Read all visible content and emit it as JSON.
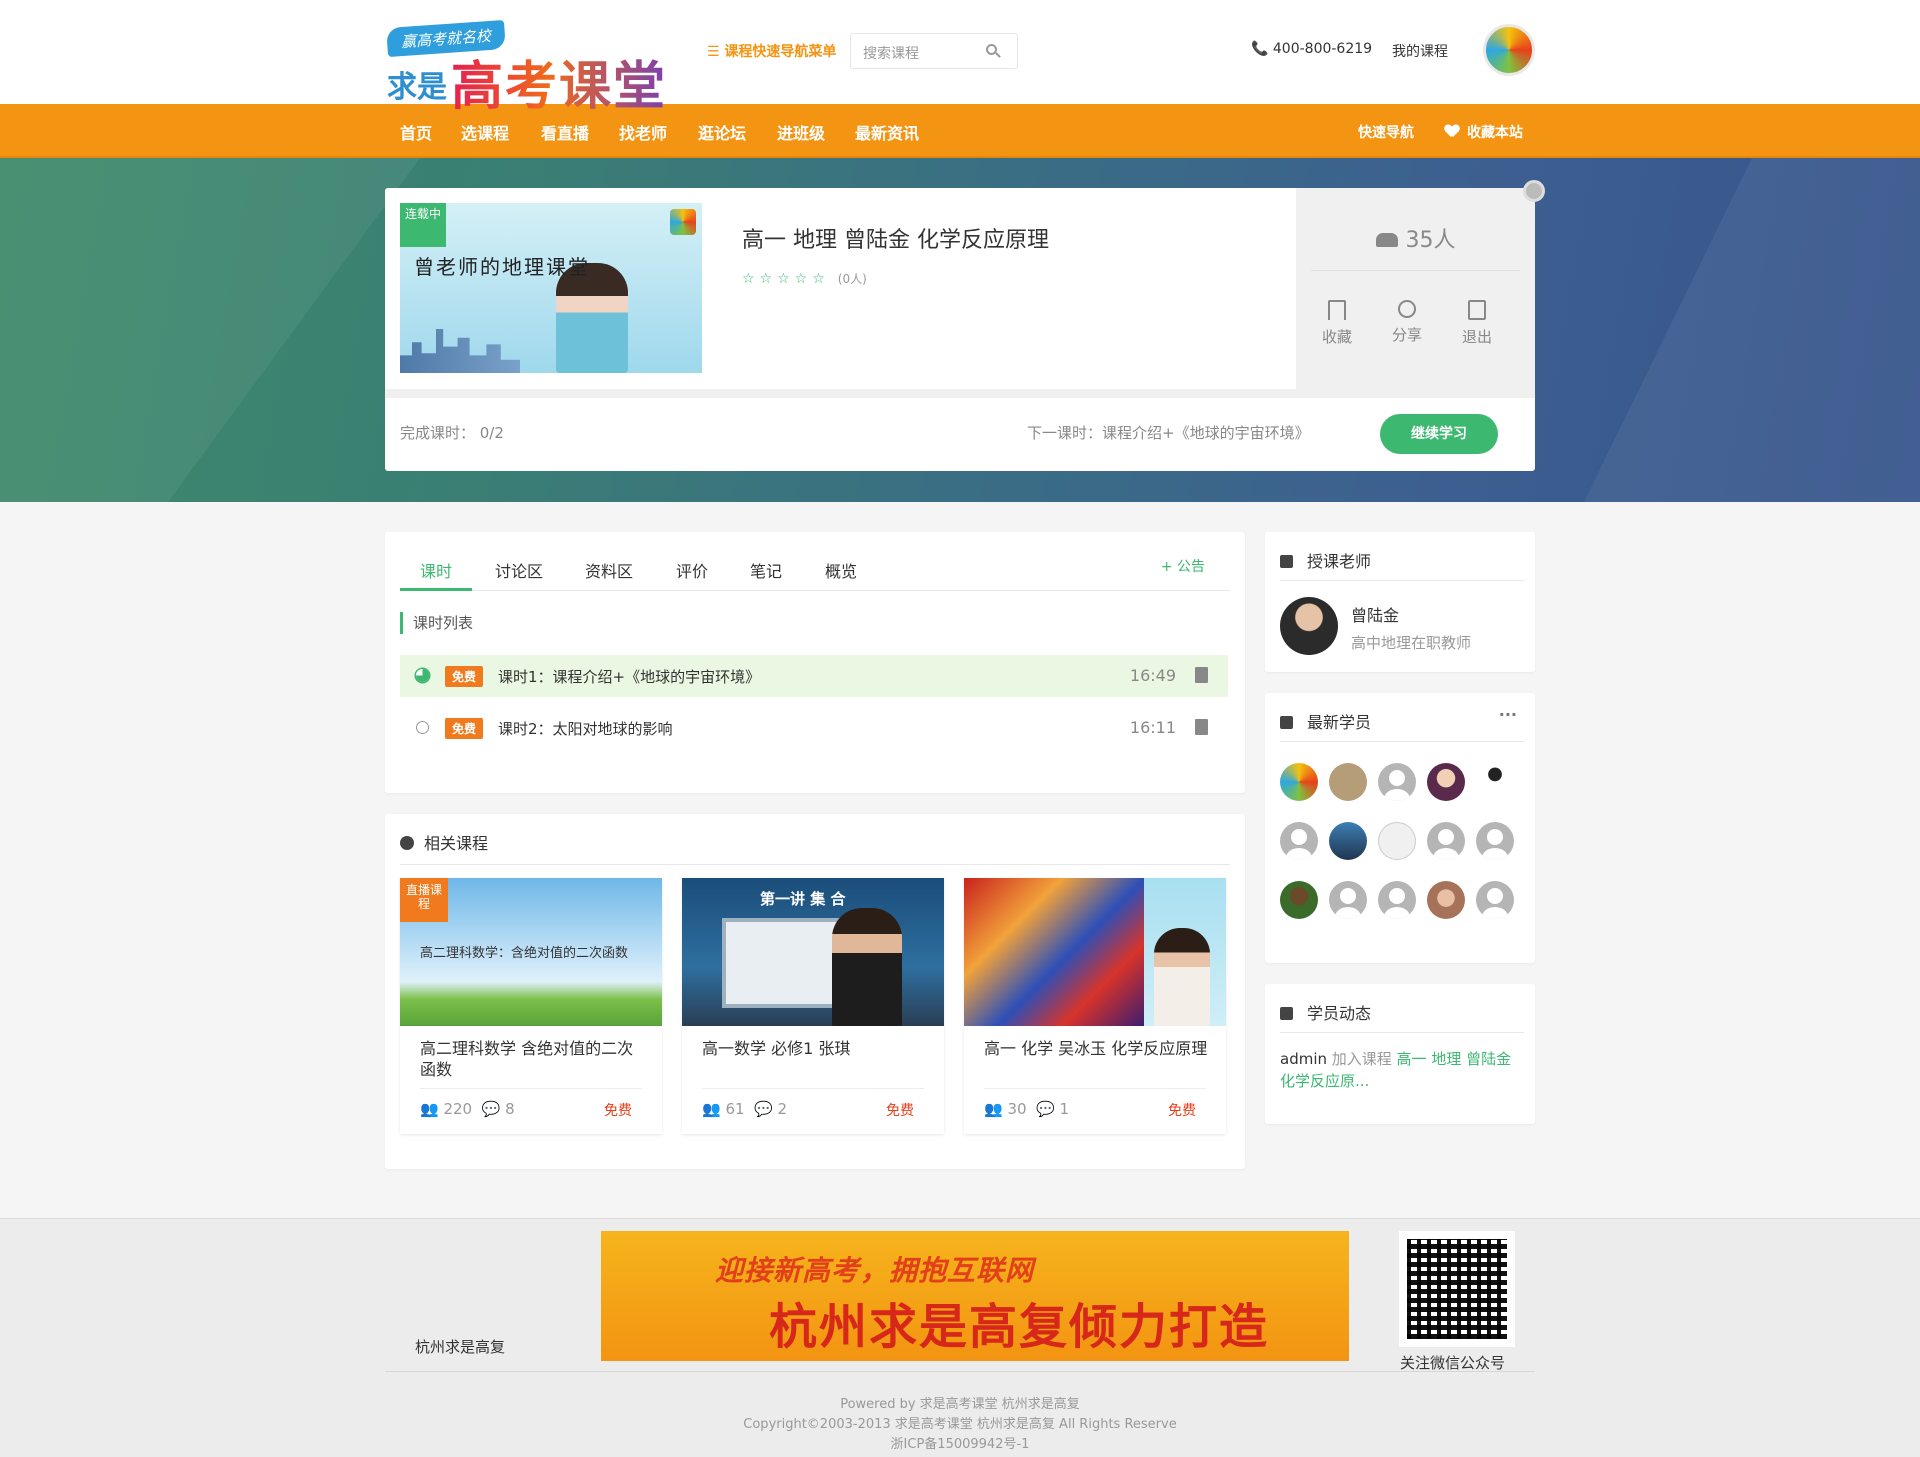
{
  "header": {
    "logo_tag": "赢高考就名校",
    "logo_prefix": "求是",
    "logo_main": "高考课堂",
    "quick_nav": "☰ 课程快速导航菜单",
    "search_placeholder": "搜索课程",
    "phone": "📞 400-800-6219",
    "my_courses": "我的课程"
  },
  "nav": {
    "items": [
      "首页",
      "选课程",
      "看直播",
      "找老师",
      "逛论坛",
      "进班级",
      "最新资讯"
    ],
    "quick": "快速导航",
    "favorite": "收藏本站"
  },
  "course": {
    "ribbon": "连载中",
    "thumb_title": "曾老师的地理课堂",
    "title": "高一 地理 曾陆金 化学反应原理",
    "stars": "☆☆☆☆☆",
    "rating_count": "(0人)",
    "students": "35人",
    "actions": [
      "收藏",
      "分享",
      "退出"
    ],
    "progress": "完成课时： 0/2",
    "next_lesson": "下一课时：课程介绍+《地球的宇宙环境》",
    "continue": "继续学习"
  },
  "tabs": [
    "课时",
    "讨论区",
    "资料区",
    "评价",
    "笔记",
    "概览"
  ],
  "notice": "+ 公告",
  "lesson_list_title": "课时列表",
  "lessons": [
    {
      "badge": "免费",
      "name": "课时1：课程介绍+《地球的宇宙环境》",
      "duration": "16:49"
    },
    {
      "badge": "免费",
      "name": "课时2：太阳对地球的影响",
      "duration": "16:11"
    }
  ],
  "related": {
    "title": "相关课程",
    "items": [
      {
        "ribbon": "直播课程",
        "img_text": "高二理科数学：含绝对值的二次函数",
        "title": "高二理科数学 含绝对值的二次函数",
        "students": "220",
        "comments": "8",
        "price": "免费"
      },
      {
        "img_text": "第一讲 集 合",
        "title": "高一数学 必修1 张琪",
        "students": "61",
        "comments": "2",
        "price": "免费"
      },
      {
        "title": "高一 化学 吴冰玉 化学反应原理",
        "students": "30",
        "comments": "1",
        "price": "免费"
      }
    ]
  },
  "teacher": {
    "title": "授课老师",
    "name": "曾陆金",
    "desc": "高中地理在职教师"
  },
  "students": {
    "title": "最新学员",
    "more": "···"
  },
  "activity": {
    "title": "学员动态",
    "user": "admin",
    "action": " 加入课程 ",
    "course": "高一 地理 曾陆金 化学反应原..."
  },
  "footer": {
    "org": "杭州求是高复",
    "banner_line1": "迎接新高考，拥抱互联网",
    "banner_line2": "杭州求是高复倾力打造",
    "qr_label": "关注微信公众号",
    "powered": "Powered by 求是高考课堂 杭州求是高复",
    "copyright": "Copyright©2003-2013 求是高考课堂 杭州求是高复 All Rights Reserve",
    "icp": "浙ICP备15009942号-1"
  },
  "colors": {
    "accent": "#3cb871",
    "nav": "#f39412",
    "free": "#f07a1d"
  }
}
